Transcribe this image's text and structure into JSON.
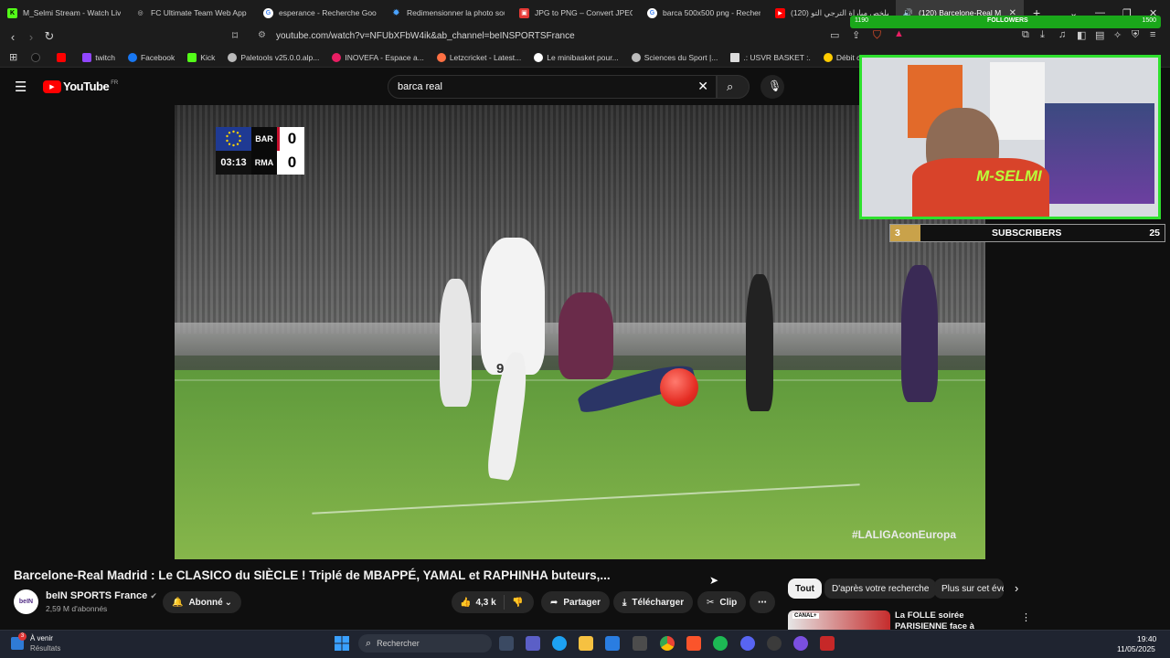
{
  "tabs": [
    {
      "title": "M_Selmi Stream - Watch Live",
      "icon": "kick-icon",
      "color": "#53fc18",
      "glyph": "K"
    },
    {
      "title": "FC Ultimate Team Web App -",
      "icon": "globe-icon",
      "color": "#888888",
      "glyph": "◎"
    },
    {
      "title": "esperance - Recherche Google",
      "icon": "google-icon",
      "color": "#ffffff",
      "glyph": "G"
    },
    {
      "title": "Redimensionner la photo sou",
      "icon": "gear-icon",
      "color": "#4aa3ff",
      "glyph": "✹"
    },
    {
      "title": "JPG to PNG – Convert JPEG to",
      "icon": "pdf-icon",
      "color": "#e53935",
      "glyph": "▣"
    },
    {
      "title": "barca 500x500 png - Recherch",
      "icon": "google-icon",
      "color": "#ffffff",
      "glyph": "G"
    },
    {
      "title": "(120) ملخص مباراة الترجي التو",
      "icon": "youtube-icon",
      "color": "#ff0000",
      "glyph": "▶"
    },
    {
      "title": "(120) Barcelone-Real M",
      "icon": "youtube-icon",
      "color": "#ff0000",
      "glyph": "▶"
    }
  ],
  "url": "youtube.com/watch?v=NFUbXFbW4ik&ab_channel=beINSPORTSFrance",
  "bookmarks": [
    {
      "label": "",
      "color": "#111111"
    },
    {
      "label": "",
      "color": "#ff0000"
    },
    {
      "label": "twitch",
      "color": "#9146ff"
    },
    {
      "label": "Facebook",
      "color": "#1877f2"
    },
    {
      "label": "Kick",
      "color": "#53fc18"
    },
    {
      "label": "Paletools v25.0.0.alp...",
      "color": "#cccccc"
    },
    {
      "label": "INOVEFA - Espace a...",
      "color": "#e91e63"
    },
    {
      "label": "Letzcricket - Latest...",
      "color": "#ff7043"
    },
    {
      "label": "Le minibasket pour...",
      "color": "#ffffff"
    },
    {
      "label": "Sciences du Sport |...",
      "color": "#cccccc"
    },
    {
      "label": ".: USVR BASKET :.",
      "color": "#dddddd"
    },
    {
      "label": "Débit cardiaque : fa...",
      "color": "#ffcc00"
    }
  ],
  "youtube": {
    "logo": "YouTube",
    "region": "FR",
    "search_value": "barca real"
  },
  "scoreboard": {
    "home": "BAR",
    "away": "RMA",
    "home_score": "0",
    "away_score": "0",
    "clock": "03:13"
  },
  "video": {
    "hashtag": "#LALIGAconEuropa",
    "player_number": "9"
  },
  "stream": {
    "followers_label": "FOLLOWERS",
    "followers_left": "1190",
    "followers_right": "1500",
    "streamer_name": "M-SELMI",
    "subs_label": "SUBSCRIBERS",
    "subs_left": "3",
    "subs_right": "25"
  },
  "meta": {
    "title": "Barcelone-Real Madrid : Le CLASICO du SIÈCLE ! Triplé de MBAPPÉ, YAMAL et RAPHINHA buteurs,...",
    "channel": "beIN SPORTS France",
    "subscribers": "2,59 M d'abonnés",
    "avatar_text": "beIN",
    "subscribed_label": "Abonné",
    "likes": "4,3 k",
    "share": "Partager",
    "download": "Télécharger",
    "clip": "Clip"
  },
  "chips": [
    "Tout",
    "D'après votre recherche",
    "Plus sur cet évé"
  ],
  "recommended": {
    "title": "La FOLLE soirée PARISIENNE face à ARSENAL",
    "thumb_tag": "CANAL+"
  },
  "taskbar": {
    "weather_top": "À venir",
    "weather_bottom": "Résultats",
    "search_placeholder": "Rechercher",
    "time": "19:40",
    "date": "11/05/2025"
  }
}
